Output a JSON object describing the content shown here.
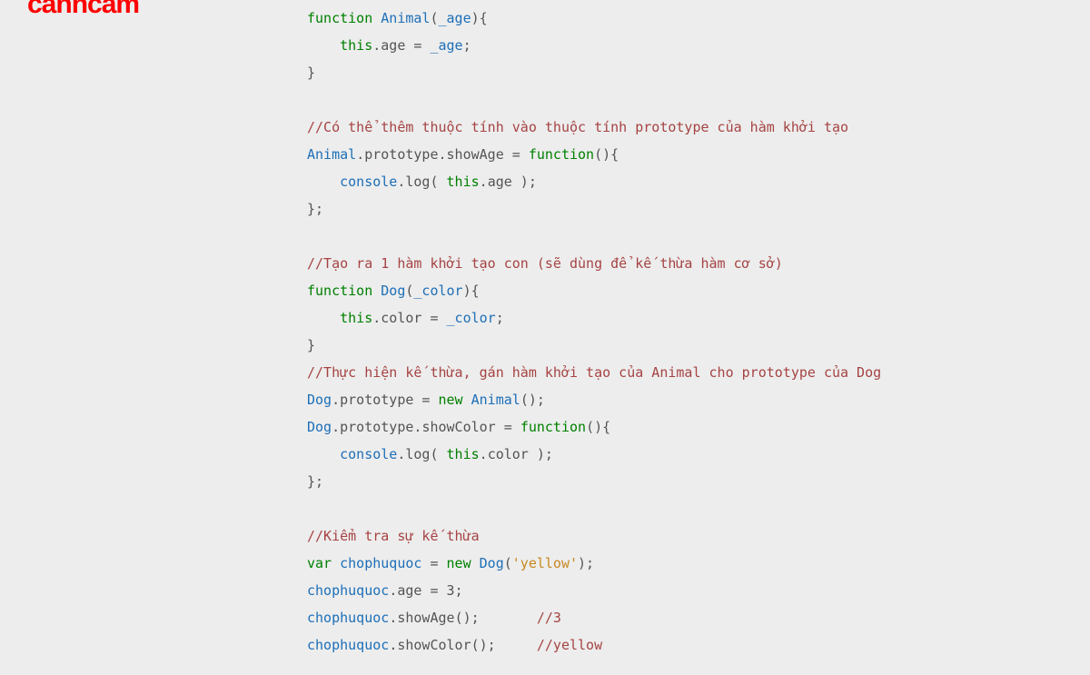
{
  "watermark": "canhcam",
  "code": {
    "kw_function": "function",
    "kw_var": "var",
    "kw_new": "new",
    "kw_this": "this",
    "nm_Animal": "Animal",
    "nm_Dog": "Dog",
    "nm_console": "console",
    "nm_chophuquoc": "chophuquoc",
    "p_age": "_age",
    "p_color": "_color",
    "prop_age": "age",
    "prop_color": "color",
    "prop_prototype": "prototype",
    "prop_showAge": "showAge",
    "prop_showColor": "showColor",
    "prop_log": "log",
    "str_yellow": "'yellow'",
    "num_3": "3",
    "cmt1": "//Có thể thêm thuộc tính vào thuộc tính prototype của hàm khởi tạo",
    "cmt2": "//Tạo ra 1 hàm khởi tạo con (sẽ dùng để kế thừa hàm cơ sở)",
    "cmt3": "//Thực hiện kế thừa, gán hàm khởi tạo của Animal cho prototype của Dog",
    "cmt4": "//Kiểm tra sự kế thừa",
    "cmt_out3": "//3",
    "cmt_outYellow": "//yellow"
  }
}
